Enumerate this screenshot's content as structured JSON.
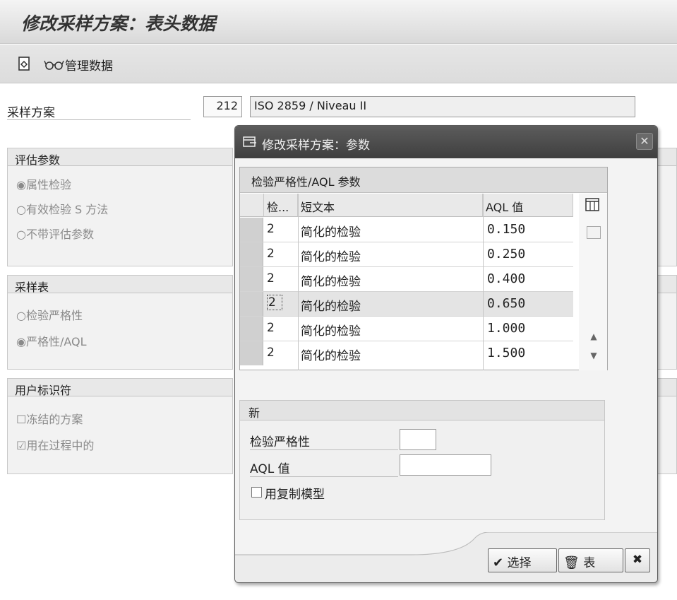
{
  "window": {
    "title": "修改采样方案：表头数据"
  },
  "toolbar": {
    "manage_data_label": "管理数据"
  },
  "header": {
    "plan_label": "采样方案",
    "plan_number": "212",
    "plan_description": "ISO 2859 / Niveau  II"
  },
  "eval_params": {
    "title": "评估参数",
    "options": [
      {
        "label": "属性检验",
        "selected": true
      },
      {
        "label": "有效检验 S 方法",
        "selected": false
      },
      {
        "label": "不带评估参数",
        "selected": false
      }
    ]
  },
  "sampling_table": {
    "title": "采样表",
    "options": [
      {
        "label": "检验严格性",
        "selected": false
      },
      {
        "label": "严格性/AQL",
        "selected": true
      }
    ]
  },
  "user_id": {
    "title": "用户标识符",
    "options": [
      {
        "label": "冻结的方案",
        "checked": false
      },
      {
        "label": "用在过程中的",
        "checked": true
      }
    ]
  },
  "dialog": {
    "title": "修改采样方案：参数",
    "table_caption": "检验严格性/AQL 参数",
    "columns": [
      "检...",
      "短文本",
      "AQL 值"
    ],
    "rows": [
      {
        "severity": "2",
        "text": "简化的检验",
        "aql": "0.150"
      },
      {
        "severity": "2",
        "text": "简化的检验",
        "aql": "0.250"
      },
      {
        "severity": "2",
        "text": "简化的检验",
        "aql": "0.400"
      },
      {
        "severity": "2",
        "text": "简化的检验",
        "aql": "0.650"
      },
      {
        "severity": "2",
        "text": "简化的检验",
        "aql": "1.000"
      },
      {
        "severity": "2",
        "text": "简化的检验",
        "aql": "1.500"
      }
    ],
    "new_group": {
      "title": "新",
      "severity_label": "检验严格性",
      "aql_label": "AQL 值",
      "copy_model_label": "用复制模型",
      "copy_model_checked": false
    },
    "buttons": {
      "choose": "选择",
      "table": "表"
    }
  }
}
